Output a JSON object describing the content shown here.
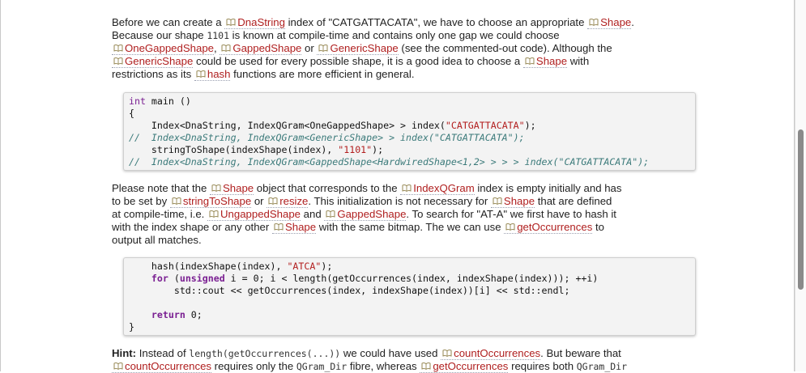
{
  "para1": {
    "t1": "Before we can create a ",
    "r1": "DnaString",
    "t2": " index of \"CATGATTACATA\", we have to choose an appropriate ",
    "r2": "Shape",
    "t3": ".",
    "t4": "Because our shape ",
    "c1": "1101",
    "t5": " is known at compile-time and contains only one gap we could choose",
    "r3": "OneGappedShape",
    "t6": ", ",
    "r4": "GappedShape",
    "t7": " or ",
    "r5": "GenericShape",
    "t8": " (see the commented-out code). Although the",
    "r6": "GenericShape",
    "t9": " could be used for every possible shape, it is a good idea to choose a ",
    "r7": "Shape",
    "t10": " with",
    "t11": "restrictions as its ",
    "r8": "hash",
    "t12": " functions are more efficient in general."
  },
  "code1": {
    "l1_a": "int",
    "l1_b": " main ()",
    "l2": "{",
    "l3_a": "    Index<DnaString, IndexQGram<OneGappedShape> > index(",
    "l3_s": "\"CATGATTACATA\"",
    "l3_b": ");",
    "l4": "//  Index<DnaString, IndexQGram<GenericShape> > index(\"CATGATTACATA\");",
    "l5_a": "    stringToShape(indexShape(index), ",
    "l5_s": "\"1101\"",
    "l5_b": ");",
    "l6": "//  Index<DnaString, IndexQGram<GappedShape<HardwiredShape<1,2> > > > index(\"CATGATTACATA\");"
  },
  "para2": {
    "t1": "Please note that the ",
    "r1": "Shape",
    "t2": " object that corresponds to the ",
    "r2": "IndexQGram",
    "t3": " index is empty initially and has",
    "t4": "to be set by ",
    "r3": "stringToShape",
    "t5": " or ",
    "r4": "resize",
    "t6": ". This initialization is not necessary for ",
    "r5": "Shape",
    "t7": " that are defined",
    "t8": "at compile-time, i.e. ",
    "r6": "UngappedShape",
    "t9": " and ",
    "r7": "GappedShape",
    "t10": ". To search for \"AT-A\" we first have to hash it",
    "t11": "with the index shape or any other ",
    "r8": "Shape",
    "t12": " with the same bitmap. The we can use ",
    "r9": "getOccurrences",
    "t13": " to",
    "t14": "output all matches."
  },
  "code2": {
    "l1_a": "    hash(indexShape(index), ",
    "l1_s": "\"ATCA\"",
    "l1_b": ");",
    "l2_k": "    for",
    "l2_a": " (",
    "l2_t": "unsigned",
    "l2_b": " i = 0; i < length(getOccurrences(index, indexShape(index))); ++i)",
    "l3": "        std::cout << getOccurrences(index, indexShape(index))[i] << std::endl;",
    "l4": "",
    "l5_k": "    return",
    "l5_b": " 0;",
    "l6": "}"
  },
  "hint": {
    "label": "Hint:",
    "t1": " Instead of ",
    "c1": "length(getOccurrences(...))",
    "t2": " we could have used ",
    "r1": "countOccurrences",
    "t3": ". But beware that",
    "r2": "countOccurrences",
    "t4": " requires only the ",
    "c2": "QGram_Dir",
    "t5": " fibre, whereas ",
    "r3": "getOccurrences",
    "t6": " requires both ",
    "c3": "QGram_Dir"
  },
  "icons": {
    "ref": "book-icon",
    "scroll": "scrollbar-thumb"
  },
  "colors": {
    "link": "#b02020",
    "keyword": "#7a1f92",
    "string": "#b21d1d",
    "comment": "#3b7a7a"
  }
}
